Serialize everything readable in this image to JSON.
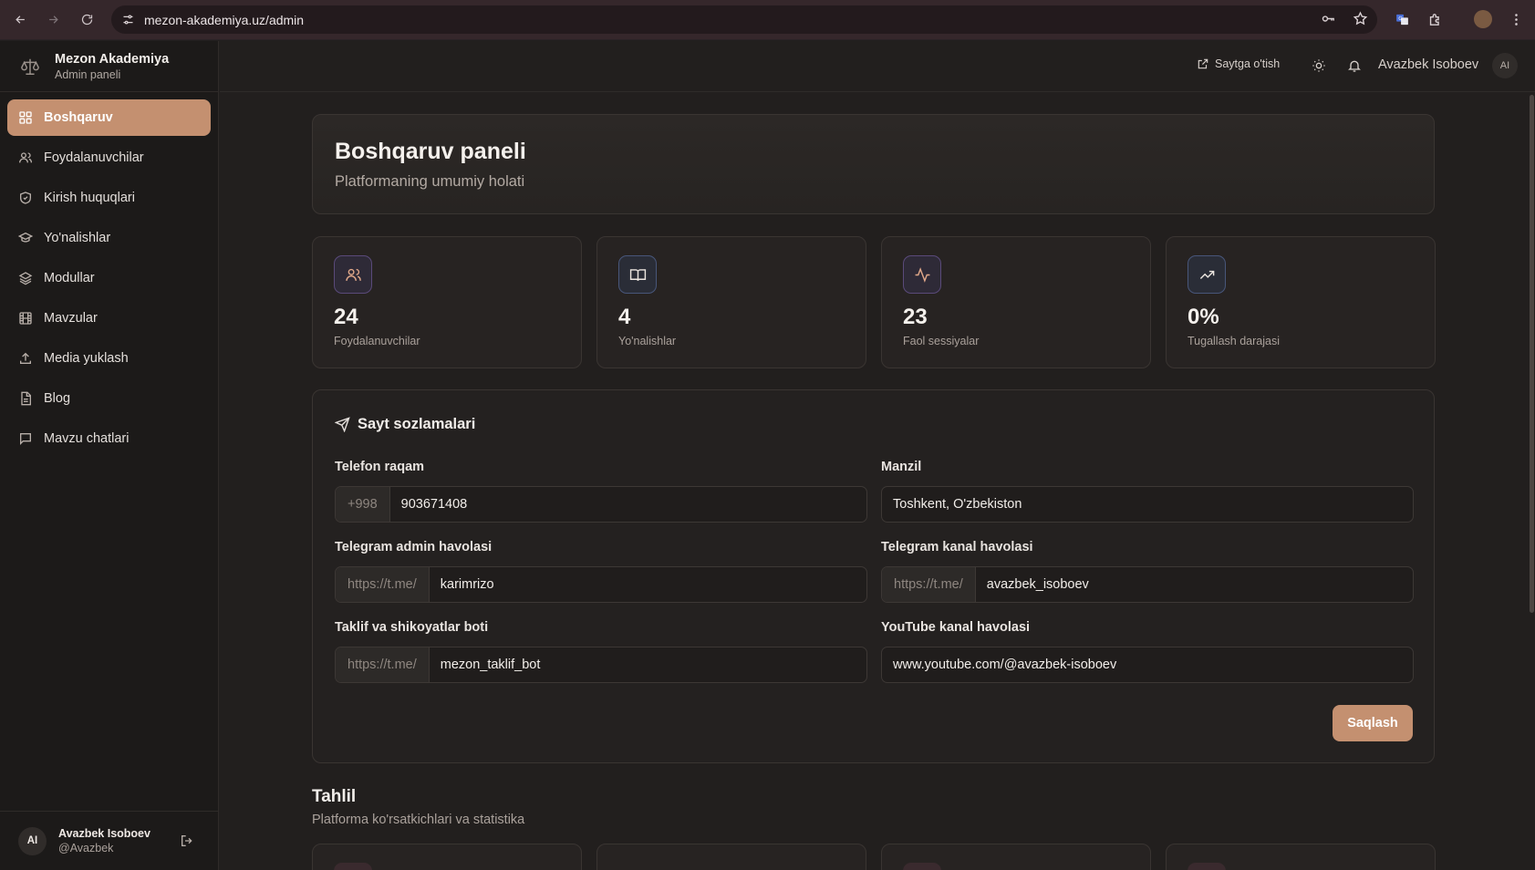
{
  "browser": {
    "url": "mezon-akademiya.uz/admin"
  },
  "sidebar": {
    "brand_title": "Mezon Akademiya",
    "brand_sub": "Admin paneli",
    "items": [
      {
        "label": "Boshqaruv",
        "icon": "dashboard-icon",
        "active": true
      },
      {
        "label": "Foydalanuvchilar",
        "icon": "users-icon"
      },
      {
        "label": "Kirish huquqlari",
        "icon": "shield-icon"
      },
      {
        "label": "Yo'nalishlar",
        "icon": "graduation-cap-icon"
      },
      {
        "label": "Modullar",
        "icon": "layers-icon"
      },
      {
        "label": "Mavzular",
        "icon": "film-icon"
      },
      {
        "label": "Media yuklash",
        "icon": "upload-icon"
      },
      {
        "label": "Blog",
        "icon": "document-icon"
      },
      {
        "label": "Mavzu chatlari",
        "icon": "chat-icon"
      }
    ],
    "user": {
      "initials": "AI",
      "name": "Avazbek Isoboev",
      "handle": "@Avazbek"
    }
  },
  "header": {
    "site_link": "Saytga o'tish",
    "user_name": "Avazbek Isoboev",
    "user_initials": "AI"
  },
  "hero": {
    "title": "Boshqaruv paneli",
    "subtitle": "Platformaning umumiy holati"
  },
  "stats": [
    {
      "value": "24",
      "label": "Foydalanuvchilar",
      "icon": "users-icon"
    },
    {
      "value": "4",
      "label": "Yo'nalishlar",
      "icon": "book-icon"
    },
    {
      "value": "23",
      "label": "Faol sessiyalar",
      "icon": "activity-icon"
    },
    {
      "value": "0%",
      "label": "Tugallash darajasi",
      "icon": "trending-up-icon"
    }
  ],
  "settings": {
    "title": "Sayt sozlamalari",
    "phone": {
      "label": "Telefon raqam",
      "prefix": "+998",
      "value": "903671408"
    },
    "address": {
      "label": "Manzil",
      "value": "Toshkent, O'zbekiston"
    },
    "tg_admin": {
      "label": "Telegram admin havolasi",
      "prefix": "https://t.me/",
      "value": "karimrizo"
    },
    "tg_channel": {
      "label": "Telegram kanal havolasi",
      "prefix": "https://t.me/",
      "value": "avazbek_isoboev"
    },
    "bot": {
      "label": "Taklif va shikoyatlar boti",
      "prefix": "https://t.me/",
      "value": "mezon_taklif_bot"
    },
    "youtube": {
      "label": "YouTube kanal havolasi",
      "value": "www.youtube.com/@avazbek-isoboev"
    },
    "save_label": "Saqlash"
  },
  "analytics": {
    "title": "Tahlil",
    "subtitle": "Platforma ko'rsatkichlari va statistika"
  },
  "colors": {
    "accent": "#c49070",
    "background": "#221f1e",
    "sidebar": "#1c1a19"
  }
}
